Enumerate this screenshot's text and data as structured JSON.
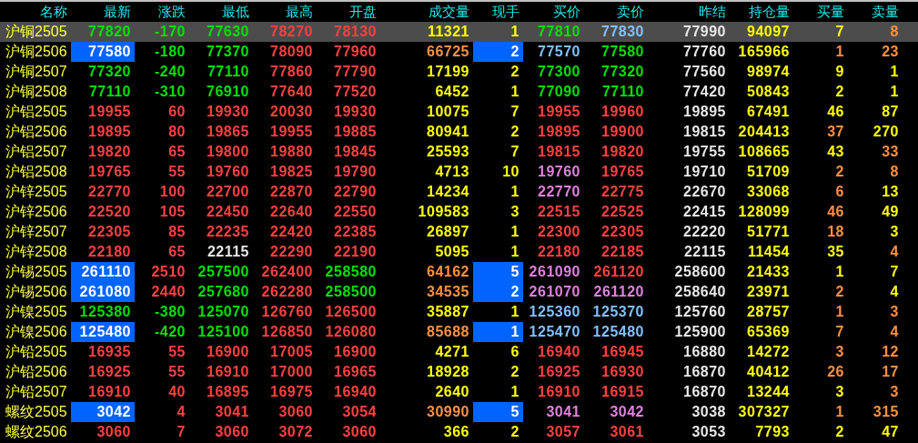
{
  "table": {
    "columns": [
      "名称",
      "最新",
      "涨跌",
      "最低",
      "最高",
      "开盘",
      "成交量",
      "现手",
      "买价",
      "卖价",
      "昨结",
      "持仓量",
      "买量",
      "卖量"
    ],
    "rows": [
      {
        "selected": true,
        "cells": [
          {
            "text": "沪铜2505",
            "color": "#ffff40",
            "highlighted": false
          },
          {
            "text": "77820",
            "color": "#00e000",
            "highlighted": false
          },
          {
            "text": "-170",
            "color": "#00e000",
            "highlighted": false
          },
          {
            "text": "77630",
            "color": "#00e000",
            "highlighted": false
          },
          {
            "text": "78270",
            "color": "#ff4040",
            "highlighted": false
          },
          {
            "text": "78130",
            "color": "#ff4040",
            "highlighted": false
          },
          {
            "text": "11321",
            "color": "#ffff00",
            "highlighted": false
          },
          {
            "text": "1",
            "color": "#ffff00",
            "highlighted": false
          },
          {
            "text": "77810",
            "color": "#00e000",
            "highlighted": false
          },
          {
            "text": "77830",
            "color": "#80c0ff",
            "highlighted": false
          },
          {
            "text": "77990",
            "color": "#e8e8e8",
            "highlighted": false
          },
          {
            "text": "94097",
            "color": "#ffff00",
            "highlighted": false
          },
          {
            "text": "7",
            "color": "#ffff00",
            "highlighted": false
          },
          {
            "text": "8",
            "color": "#ff9040",
            "highlighted": false
          }
        ]
      },
      {
        "selected": false,
        "cells": [
          {
            "text": "沪铜2506",
            "color": "#ffff40",
            "highlighted": false
          },
          {
            "text": "77580",
            "color": "#ffffff",
            "highlighted": true
          },
          {
            "text": "-180",
            "color": "#00e000",
            "highlighted": false
          },
          {
            "text": "77370",
            "color": "#00e000",
            "highlighted": false
          },
          {
            "text": "78090",
            "color": "#ff4040",
            "highlighted": false
          },
          {
            "text": "77960",
            "color": "#ff4040",
            "highlighted": false
          },
          {
            "text": "66725",
            "color": "#ff9040",
            "highlighted": false
          },
          {
            "text": "2",
            "color": "#ffffff",
            "highlighted": true
          },
          {
            "text": "77570",
            "color": "#80c0ff",
            "highlighted": false
          },
          {
            "text": "77580",
            "color": "#00e000",
            "highlighted": false
          },
          {
            "text": "77760",
            "color": "#e8e8e8",
            "highlighted": false
          },
          {
            "text": "165966",
            "color": "#ffff00",
            "highlighted": false
          },
          {
            "text": "1",
            "color": "#ff9040",
            "highlighted": false
          },
          {
            "text": "23",
            "color": "#ff9040",
            "highlighted": false
          }
        ]
      },
      {
        "selected": false,
        "cells": [
          {
            "text": "沪铜2507",
            "color": "#ffff40",
            "highlighted": false
          },
          {
            "text": "77320",
            "color": "#00e000",
            "highlighted": false
          },
          {
            "text": "-240",
            "color": "#00e000",
            "highlighted": false
          },
          {
            "text": "77110",
            "color": "#00e000",
            "highlighted": false
          },
          {
            "text": "77860",
            "color": "#ff4040",
            "highlighted": false
          },
          {
            "text": "77790",
            "color": "#ff4040",
            "highlighted": false
          },
          {
            "text": "17199",
            "color": "#ffff00",
            "highlighted": false
          },
          {
            "text": "2",
            "color": "#ffff00",
            "highlighted": false
          },
          {
            "text": "77300",
            "color": "#00e000",
            "highlighted": false
          },
          {
            "text": "77320",
            "color": "#00e000",
            "highlighted": false
          },
          {
            "text": "77560",
            "color": "#e8e8e8",
            "highlighted": false
          },
          {
            "text": "98974",
            "color": "#ffff00",
            "highlighted": false
          },
          {
            "text": "9",
            "color": "#ffff00",
            "highlighted": false
          },
          {
            "text": "1",
            "color": "#ffff00",
            "highlighted": false
          }
        ]
      },
      {
        "selected": false,
        "cells": [
          {
            "text": "沪铜2508",
            "color": "#ffff40",
            "highlighted": false
          },
          {
            "text": "77110",
            "color": "#00e000",
            "highlighted": false
          },
          {
            "text": "-310",
            "color": "#00e000",
            "highlighted": false
          },
          {
            "text": "76910",
            "color": "#00e000",
            "highlighted": false
          },
          {
            "text": "77640",
            "color": "#ff4040",
            "highlighted": false
          },
          {
            "text": "77520",
            "color": "#ff4040",
            "highlighted": false
          },
          {
            "text": "6452",
            "color": "#ffff00",
            "highlighted": false
          },
          {
            "text": "1",
            "color": "#ffff00",
            "highlighted": false
          },
          {
            "text": "77090",
            "color": "#00e000",
            "highlighted": false
          },
          {
            "text": "77110",
            "color": "#00e000",
            "highlighted": false
          },
          {
            "text": "77420",
            "color": "#e8e8e8",
            "highlighted": false
          },
          {
            "text": "50843",
            "color": "#ffff00",
            "highlighted": false
          },
          {
            "text": "2",
            "color": "#ffff00",
            "highlighted": false
          },
          {
            "text": "1",
            "color": "#ffff00",
            "highlighted": false
          }
        ]
      },
      {
        "selected": false,
        "cells": [
          {
            "text": "沪铝2505",
            "color": "#ffff40",
            "highlighted": false
          },
          {
            "text": "19955",
            "color": "#ff4040",
            "highlighted": false
          },
          {
            "text": "60",
            "color": "#ff4040",
            "highlighted": false
          },
          {
            "text": "19930",
            "color": "#ff4040",
            "highlighted": false
          },
          {
            "text": "20030",
            "color": "#ff4040",
            "highlighted": false
          },
          {
            "text": "19930",
            "color": "#ff4040",
            "highlighted": false
          },
          {
            "text": "10075",
            "color": "#ffff00",
            "highlighted": false
          },
          {
            "text": "7",
            "color": "#ffff00",
            "highlighted": false
          },
          {
            "text": "19955",
            "color": "#ff4040",
            "highlighted": false
          },
          {
            "text": "19960",
            "color": "#ff4040",
            "highlighted": false
          },
          {
            "text": "19895",
            "color": "#e8e8e8",
            "highlighted": false
          },
          {
            "text": "67491",
            "color": "#ffff00",
            "highlighted": false
          },
          {
            "text": "46",
            "color": "#ffff00",
            "highlighted": false
          },
          {
            "text": "87",
            "color": "#ffff00",
            "highlighted": false
          }
        ]
      },
      {
        "selected": false,
        "cells": [
          {
            "text": "沪铝2506",
            "color": "#ffff40",
            "highlighted": false
          },
          {
            "text": "19895",
            "color": "#ff4040",
            "highlighted": false
          },
          {
            "text": "80",
            "color": "#ff4040",
            "highlighted": false
          },
          {
            "text": "19865",
            "color": "#ff4040",
            "highlighted": false
          },
          {
            "text": "19955",
            "color": "#ff4040",
            "highlighted": false
          },
          {
            "text": "19885",
            "color": "#ff4040",
            "highlighted": false
          },
          {
            "text": "80941",
            "color": "#ffff00",
            "highlighted": false
          },
          {
            "text": "2",
            "color": "#ffff00",
            "highlighted": false
          },
          {
            "text": "19895",
            "color": "#ff4040",
            "highlighted": false
          },
          {
            "text": "19900",
            "color": "#ff4040",
            "highlighted": false
          },
          {
            "text": "19815",
            "color": "#e8e8e8",
            "highlighted": false
          },
          {
            "text": "204413",
            "color": "#ffff00",
            "highlighted": false
          },
          {
            "text": "37",
            "color": "#ff9040",
            "highlighted": false
          },
          {
            "text": "270",
            "color": "#ffff00",
            "highlighted": false
          }
        ]
      },
      {
        "selected": false,
        "cells": [
          {
            "text": "沪铝2507",
            "color": "#ffff40",
            "highlighted": false
          },
          {
            "text": "19820",
            "color": "#ff4040",
            "highlighted": false
          },
          {
            "text": "65",
            "color": "#ff4040",
            "highlighted": false
          },
          {
            "text": "19800",
            "color": "#ff4040",
            "highlighted": false
          },
          {
            "text": "19880",
            "color": "#ff4040",
            "highlighted": false
          },
          {
            "text": "19845",
            "color": "#ff4040",
            "highlighted": false
          },
          {
            "text": "25593",
            "color": "#ffff00",
            "highlighted": false
          },
          {
            "text": "7",
            "color": "#ffff00",
            "highlighted": false
          },
          {
            "text": "19815",
            "color": "#ff4040",
            "highlighted": false
          },
          {
            "text": "19820",
            "color": "#ff4040",
            "highlighted": false
          },
          {
            "text": "19755",
            "color": "#e8e8e8",
            "highlighted": false
          },
          {
            "text": "108665",
            "color": "#ffff00",
            "highlighted": false
          },
          {
            "text": "43",
            "color": "#ffff00",
            "highlighted": false
          },
          {
            "text": "33",
            "color": "#ff9040",
            "highlighted": false
          }
        ]
      },
      {
        "selected": false,
        "cells": [
          {
            "text": "沪铝2508",
            "color": "#ffff40",
            "highlighted": false
          },
          {
            "text": "19765",
            "color": "#ff4040",
            "highlighted": false
          },
          {
            "text": "55",
            "color": "#ff4040",
            "highlighted": false
          },
          {
            "text": "19760",
            "color": "#ff4040",
            "highlighted": false
          },
          {
            "text": "19825",
            "color": "#ff4040",
            "highlighted": false
          },
          {
            "text": "19790",
            "color": "#ff4040",
            "highlighted": false
          },
          {
            "text": "4713",
            "color": "#ffff00",
            "highlighted": false
          },
          {
            "text": "10",
            "color": "#ffff00",
            "highlighted": false
          },
          {
            "text": "19760",
            "color": "#e080e0",
            "highlighted": false
          },
          {
            "text": "19765",
            "color": "#ff4040",
            "highlighted": false
          },
          {
            "text": "19710",
            "color": "#e8e8e8",
            "highlighted": false
          },
          {
            "text": "51709",
            "color": "#ffff00",
            "highlighted": false
          },
          {
            "text": "2",
            "color": "#ff9040",
            "highlighted": false
          },
          {
            "text": "8",
            "color": "#ff9040",
            "highlighted": false
          }
        ]
      },
      {
        "selected": false,
        "cells": [
          {
            "text": "沪锌2505",
            "color": "#ffff40",
            "highlighted": false
          },
          {
            "text": "22770",
            "color": "#ff4040",
            "highlighted": false
          },
          {
            "text": "100",
            "color": "#ff4040",
            "highlighted": false
          },
          {
            "text": "22700",
            "color": "#ff4040",
            "highlighted": false
          },
          {
            "text": "22870",
            "color": "#ff4040",
            "highlighted": false
          },
          {
            "text": "22790",
            "color": "#ff4040",
            "highlighted": false
          },
          {
            "text": "14234",
            "color": "#ffff00",
            "highlighted": false
          },
          {
            "text": "1",
            "color": "#ffff00",
            "highlighted": false
          },
          {
            "text": "22770",
            "color": "#e080e0",
            "highlighted": false
          },
          {
            "text": "22775",
            "color": "#ff4040",
            "highlighted": false
          },
          {
            "text": "22670",
            "color": "#e8e8e8",
            "highlighted": false
          },
          {
            "text": "33068",
            "color": "#ffff00",
            "highlighted": false
          },
          {
            "text": "6",
            "color": "#ff9040",
            "highlighted": false
          },
          {
            "text": "13",
            "color": "#ffff00",
            "highlighted": false
          }
        ]
      },
      {
        "selected": false,
        "cells": [
          {
            "text": "沪锌2506",
            "color": "#ffff40",
            "highlighted": false
          },
          {
            "text": "22520",
            "color": "#ff4040",
            "highlighted": false
          },
          {
            "text": "105",
            "color": "#ff4040",
            "highlighted": false
          },
          {
            "text": "22450",
            "color": "#ff4040",
            "highlighted": false
          },
          {
            "text": "22640",
            "color": "#ff4040",
            "highlighted": false
          },
          {
            "text": "22550",
            "color": "#ff4040",
            "highlighted": false
          },
          {
            "text": "109583",
            "color": "#ffff00",
            "highlighted": false
          },
          {
            "text": "3",
            "color": "#ffff00",
            "highlighted": false
          },
          {
            "text": "22515",
            "color": "#ff4040",
            "highlighted": false
          },
          {
            "text": "22525",
            "color": "#ff4040",
            "highlighted": false
          },
          {
            "text": "22415",
            "color": "#e8e8e8",
            "highlighted": false
          },
          {
            "text": "128099",
            "color": "#ffff00",
            "highlighted": false
          },
          {
            "text": "46",
            "color": "#ff9040",
            "highlighted": false
          },
          {
            "text": "49",
            "color": "#ffff00",
            "highlighted": false
          }
        ]
      },
      {
        "selected": false,
        "cells": [
          {
            "text": "沪锌2507",
            "color": "#ffff40",
            "highlighted": false
          },
          {
            "text": "22305",
            "color": "#ff4040",
            "highlighted": false
          },
          {
            "text": "85",
            "color": "#ff4040",
            "highlighted": false
          },
          {
            "text": "22235",
            "color": "#ff4040",
            "highlighted": false
          },
          {
            "text": "22420",
            "color": "#ff4040",
            "highlighted": false
          },
          {
            "text": "22385",
            "color": "#ff4040",
            "highlighted": false
          },
          {
            "text": "26897",
            "color": "#ffff00",
            "highlighted": false
          },
          {
            "text": "1",
            "color": "#ffff00",
            "highlighted": false
          },
          {
            "text": "22300",
            "color": "#ff4040",
            "highlighted": false
          },
          {
            "text": "22305",
            "color": "#ff4040",
            "highlighted": false
          },
          {
            "text": "22220",
            "color": "#e8e8e8",
            "highlighted": false
          },
          {
            "text": "51771",
            "color": "#ffff00",
            "highlighted": false
          },
          {
            "text": "18",
            "color": "#ff9040",
            "highlighted": false
          },
          {
            "text": "3",
            "color": "#ffff00",
            "highlighted": false
          }
        ]
      },
      {
        "selected": false,
        "cells": [
          {
            "text": "沪锌2508",
            "color": "#ffff40",
            "highlighted": false
          },
          {
            "text": "22180",
            "color": "#ff4040",
            "highlighted": false
          },
          {
            "text": "65",
            "color": "#ff4040",
            "highlighted": false
          },
          {
            "text": "22115",
            "color": "#e8e8e8",
            "highlighted": false
          },
          {
            "text": "22290",
            "color": "#ff4040",
            "highlighted": false
          },
          {
            "text": "22190",
            "color": "#ff4040",
            "highlighted": false
          },
          {
            "text": "5095",
            "color": "#ffff00",
            "highlighted": false
          },
          {
            "text": "1",
            "color": "#ffff00",
            "highlighted": false
          },
          {
            "text": "22180",
            "color": "#ff4040",
            "highlighted": false
          },
          {
            "text": "22185",
            "color": "#ff4040",
            "highlighted": false
          },
          {
            "text": "22115",
            "color": "#e8e8e8",
            "highlighted": false
          },
          {
            "text": "11454",
            "color": "#ffff00",
            "highlighted": false
          },
          {
            "text": "35",
            "color": "#ffff00",
            "highlighted": false
          },
          {
            "text": "4",
            "color": "#ff9040",
            "highlighted": false
          }
        ]
      },
      {
        "selected": false,
        "cells": [
          {
            "text": "沪锡2505",
            "color": "#ffff40",
            "highlighted": false
          },
          {
            "text": "261110",
            "color": "#ffffff",
            "highlighted": true
          },
          {
            "text": "2510",
            "color": "#ff4040",
            "highlighted": false
          },
          {
            "text": "257500",
            "color": "#00e000",
            "highlighted": false
          },
          {
            "text": "262400",
            "color": "#ff4040",
            "highlighted": false
          },
          {
            "text": "258580",
            "color": "#00e000",
            "highlighted": false
          },
          {
            "text": "64162",
            "color": "#ff9040",
            "highlighted": false
          },
          {
            "text": "5",
            "color": "#ffffff",
            "highlighted": true
          },
          {
            "text": "261090",
            "color": "#e080e0",
            "highlighted": false
          },
          {
            "text": "261120",
            "color": "#ff4040",
            "highlighted": false
          },
          {
            "text": "258600",
            "color": "#e8e8e8",
            "highlighted": false
          },
          {
            "text": "21433",
            "color": "#ffff00",
            "highlighted": false
          },
          {
            "text": "1",
            "color": "#ffff00",
            "highlighted": false
          },
          {
            "text": "7",
            "color": "#ffff00",
            "highlighted": false
          }
        ]
      },
      {
        "selected": false,
        "cells": [
          {
            "text": "沪锡2506",
            "color": "#ffff40",
            "highlighted": false
          },
          {
            "text": "261080",
            "color": "#ffffff",
            "highlighted": true
          },
          {
            "text": "2440",
            "color": "#ff4040",
            "highlighted": false
          },
          {
            "text": "257680",
            "color": "#00e000",
            "highlighted": false
          },
          {
            "text": "262280",
            "color": "#ff4040",
            "highlighted": false
          },
          {
            "text": "258500",
            "color": "#00e000",
            "highlighted": false
          },
          {
            "text": "34535",
            "color": "#ff9040",
            "highlighted": false
          },
          {
            "text": "2",
            "color": "#ffffff",
            "highlighted": true
          },
          {
            "text": "261070",
            "color": "#e080e0",
            "highlighted": false
          },
          {
            "text": "261120",
            "color": "#e080e0",
            "highlighted": false
          },
          {
            "text": "258640",
            "color": "#e8e8e8",
            "highlighted": false
          },
          {
            "text": "23971",
            "color": "#ffff00",
            "highlighted": false
          },
          {
            "text": "2",
            "color": "#ff9040",
            "highlighted": false
          },
          {
            "text": "4",
            "color": "#ffff00",
            "highlighted": false
          }
        ]
      },
      {
        "selected": false,
        "cells": [
          {
            "text": "沪镍2505",
            "color": "#ffff40",
            "highlighted": false
          },
          {
            "text": "125380",
            "color": "#00e000",
            "highlighted": false
          },
          {
            "text": "-380",
            "color": "#00e000",
            "highlighted": false
          },
          {
            "text": "125070",
            "color": "#00e000",
            "highlighted": false
          },
          {
            "text": "126760",
            "color": "#ff4040",
            "highlighted": false
          },
          {
            "text": "126500",
            "color": "#ff4040",
            "highlighted": false
          },
          {
            "text": "35887",
            "color": "#ffff00",
            "highlighted": false
          },
          {
            "text": "1",
            "color": "#ffff00",
            "highlighted": false
          },
          {
            "text": "125360",
            "color": "#80c0ff",
            "highlighted": false
          },
          {
            "text": "125370",
            "color": "#80c0ff",
            "highlighted": false
          },
          {
            "text": "125760",
            "color": "#e8e8e8",
            "highlighted": false
          },
          {
            "text": "28757",
            "color": "#ffff00",
            "highlighted": false
          },
          {
            "text": "1",
            "color": "#ff9040",
            "highlighted": false
          },
          {
            "text": "3",
            "color": "#ff9040",
            "highlighted": false
          }
        ]
      },
      {
        "selected": false,
        "cells": [
          {
            "text": "沪镍2506",
            "color": "#ffff40",
            "highlighted": false
          },
          {
            "text": "125480",
            "color": "#ffffff",
            "highlighted": true
          },
          {
            "text": "-420",
            "color": "#00e000",
            "highlighted": false
          },
          {
            "text": "125100",
            "color": "#00e000",
            "highlighted": false
          },
          {
            "text": "126850",
            "color": "#ff4040",
            "highlighted": false
          },
          {
            "text": "126080",
            "color": "#ff4040",
            "highlighted": false
          },
          {
            "text": "85688",
            "color": "#ff9040",
            "highlighted": false
          },
          {
            "text": "1",
            "color": "#ffffff",
            "highlighted": true
          },
          {
            "text": "125470",
            "color": "#80c0ff",
            "highlighted": false
          },
          {
            "text": "125480",
            "color": "#80c0ff",
            "highlighted": false
          },
          {
            "text": "125900",
            "color": "#e8e8e8",
            "highlighted": false
          },
          {
            "text": "65369",
            "color": "#ffff00",
            "highlighted": false
          },
          {
            "text": "7",
            "color": "#ff9040",
            "highlighted": false
          },
          {
            "text": "4",
            "color": "#ff9040",
            "highlighted": false
          }
        ]
      },
      {
        "selected": false,
        "cells": [
          {
            "text": "沪铅2505",
            "color": "#ffff40",
            "highlighted": false
          },
          {
            "text": "16935",
            "color": "#ff4040",
            "highlighted": false
          },
          {
            "text": "55",
            "color": "#ff4040",
            "highlighted": false
          },
          {
            "text": "16900",
            "color": "#ff4040",
            "highlighted": false
          },
          {
            "text": "17005",
            "color": "#ff4040",
            "highlighted": false
          },
          {
            "text": "16900",
            "color": "#ff4040",
            "highlighted": false
          },
          {
            "text": "4271",
            "color": "#ffff00",
            "highlighted": false
          },
          {
            "text": "6",
            "color": "#ffff00",
            "highlighted": false
          },
          {
            "text": "16940",
            "color": "#ff4040",
            "highlighted": false
          },
          {
            "text": "16945",
            "color": "#ff4040",
            "highlighted": false
          },
          {
            "text": "16880",
            "color": "#e8e8e8",
            "highlighted": false
          },
          {
            "text": "14272",
            "color": "#ffff00",
            "highlighted": false
          },
          {
            "text": "3",
            "color": "#ff9040",
            "highlighted": false
          },
          {
            "text": "12",
            "color": "#ff9040",
            "highlighted": false
          }
        ]
      },
      {
        "selected": false,
        "cells": [
          {
            "text": "沪铅2506",
            "color": "#ffff40",
            "highlighted": false
          },
          {
            "text": "16925",
            "color": "#ff4040",
            "highlighted": false
          },
          {
            "text": "55",
            "color": "#ff4040",
            "highlighted": false
          },
          {
            "text": "16910",
            "color": "#ff4040",
            "highlighted": false
          },
          {
            "text": "17000",
            "color": "#ff4040",
            "highlighted": false
          },
          {
            "text": "16965",
            "color": "#ff4040",
            "highlighted": false
          },
          {
            "text": "18928",
            "color": "#ffff00",
            "highlighted": false
          },
          {
            "text": "2",
            "color": "#ffff00",
            "highlighted": false
          },
          {
            "text": "16925",
            "color": "#ff4040",
            "highlighted": false
          },
          {
            "text": "16930",
            "color": "#ff4040",
            "highlighted": false
          },
          {
            "text": "16870",
            "color": "#e8e8e8",
            "highlighted": false
          },
          {
            "text": "40412",
            "color": "#ffff00",
            "highlighted": false
          },
          {
            "text": "26",
            "color": "#ff9040",
            "highlighted": false
          },
          {
            "text": "17",
            "color": "#ff9040",
            "highlighted": false
          }
        ]
      },
      {
        "selected": false,
        "cells": [
          {
            "text": "沪铅2507",
            "color": "#ffff40",
            "highlighted": false
          },
          {
            "text": "16910",
            "color": "#ff4040",
            "highlighted": false
          },
          {
            "text": "40",
            "color": "#ff4040",
            "highlighted": false
          },
          {
            "text": "16895",
            "color": "#ff4040",
            "highlighted": false
          },
          {
            "text": "16975",
            "color": "#ff4040",
            "highlighted": false
          },
          {
            "text": "16940",
            "color": "#ff4040",
            "highlighted": false
          },
          {
            "text": "2640",
            "color": "#ffff00",
            "highlighted": false
          },
          {
            "text": "1",
            "color": "#ffff00",
            "highlighted": false
          },
          {
            "text": "16910",
            "color": "#ff4040",
            "highlighted": false
          },
          {
            "text": "16915",
            "color": "#ff4040",
            "highlighted": false
          },
          {
            "text": "16870",
            "color": "#e8e8e8",
            "highlighted": false
          },
          {
            "text": "13244",
            "color": "#ffff00",
            "highlighted": false
          },
          {
            "text": "3",
            "color": "#ffff00",
            "highlighted": false
          },
          {
            "text": "3",
            "color": "#ff9040",
            "highlighted": false
          }
        ]
      },
      {
        "selected": false,
        "cells": [
          {
            "text": "螺纹2505",
            "color": "#ffff40",
            "highlighted": false
          },
          {
            "text": "3042",
            "color": "#ffffff",
            "highlighted": true
          },
          {
            "text": "4",
            "color": "#ff4040",
            "highlighted": false
          },
          {
            "text": "3041",
            "color": "#ff4040",
            "highlighted": false
          },
          {
            "text": "3060",
            "color": "#ff4040",
            "highlighted": false
          },
          {
            "text": "3054",
            "color": "#ff4040",
            "highlighted": false
          },
          {
            "text": "30990",
            "color": "#ff9040",
            "highlighted": false
          },
          {
            "text": "5",
            "color": "#ffffff",
            "highlighted": true
          },
          {
            "text": "3041",
            "color": "#e080e0",
            "highlighted": false
          },
          {
            "text": "3042",
            "color": "#e080e0",
            "highlighted": false
          },
          {
            "text": "3038",
            "color": "#e8e8e8",
            "highlighted": false
          },
          {
            "text": "307327",
            "color": "#ffff00",
            "highlighted": false
          },
          {
            "text": "1",
            "color": "#ff9040",
            "highlighted": false
          },
          {
            "text": "315",
            "color": "#ff9040",
            "highlighted": false
          }
        ]
      },
      {
        "selected": false,
        "cells": [
          {
            "text": "螺纹2506",
            "color": "#ffff40",
            "highlighted": false
          },
          {
            "text": "3060",
            "color": "#ff4040",
            "highlighted": false
          },
          {
            "text": "7",
            "color": "#ff4040",
            "highlighted": false
          },
          {
            "text": "3060",
            "color": "#ff4040",
            "highlighted": false
          },
          {
            "text": "3072",
            "color": "#ff4040",
            "highlighted": false
          },
          {
            "text": "3060",
            "color": "#ff4040",
            "highlighted": false
          },
          {
            "text": "366",
            "color": "#ffff00",
            "highlighted": false
          },
          {
            "text": "2",
            "color": "#ffff00",
            "highlighted": false
          },
          {
            "text": "3057",
            "color": "#ff4040",
            "highlighted": false
          },
          {
            "text": "3061",
            "color": "#ff4040",
            "highlighted": false
          },
          {
            "text": "3053",
            "color": "#e8e8e8",
            "highlighted": false
          },
          {
            "text": "7793",
            "color": "#ffff00",
            "highlighted": false
          },
          {
            "text": "2",
            "color": "#ffff00",
            "highlighted": false
          },
          {
            "text": "47",
            "color": "#ffff00",
            "highlighted": false
          }
        ]
      }
    ]
  }
}
